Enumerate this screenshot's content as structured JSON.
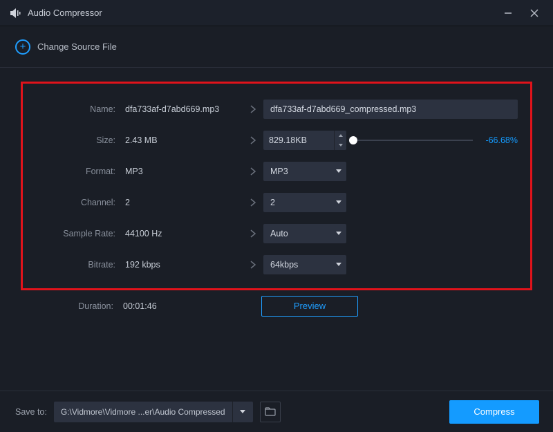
{
  "titlebar": {
    "app_name": "Audio Compressor"
  },
  "toolbar": {
    "change_source": "Change Source File"
  },
  "labels": {
    "name": "Name:",
    "size": "Size:",
    "format": "Format:",
    "channel": "Channel:",
    "sample_rate": "Sample Rate:",
    "bitrate": "Bitrate:",
    "duration": "Duration:"
  },
  "source": {
    "name": "dfa733af-d7abd669.mp3",
    "size": "2.43 MB",
    "format": "MP3",
    "channel": "2",
    "sample_rate": "44100 Hz",
    "bitrate": "192 kbps",
    "duration": "00:01:46"
  },
  "target": {
    "name": "dfa733af-d7abd669_compressed.mp3",
    "size": "829.18KB",
    "size_reduction": "-66.68%",
    "format": "MP3",
    "channel": "2",
    "sample_rate": "Auto",
    "bitrate": "64kbps"
  },
  "buttons": {
    "preview": "Preview",
    "compress": "Compress"
  },
  "footer": {
    "save_to_label": "Save to:",
    "save_path": "G:\\Vidmore\\Vidmore ...er\\Audio Compressed"
  }
}
